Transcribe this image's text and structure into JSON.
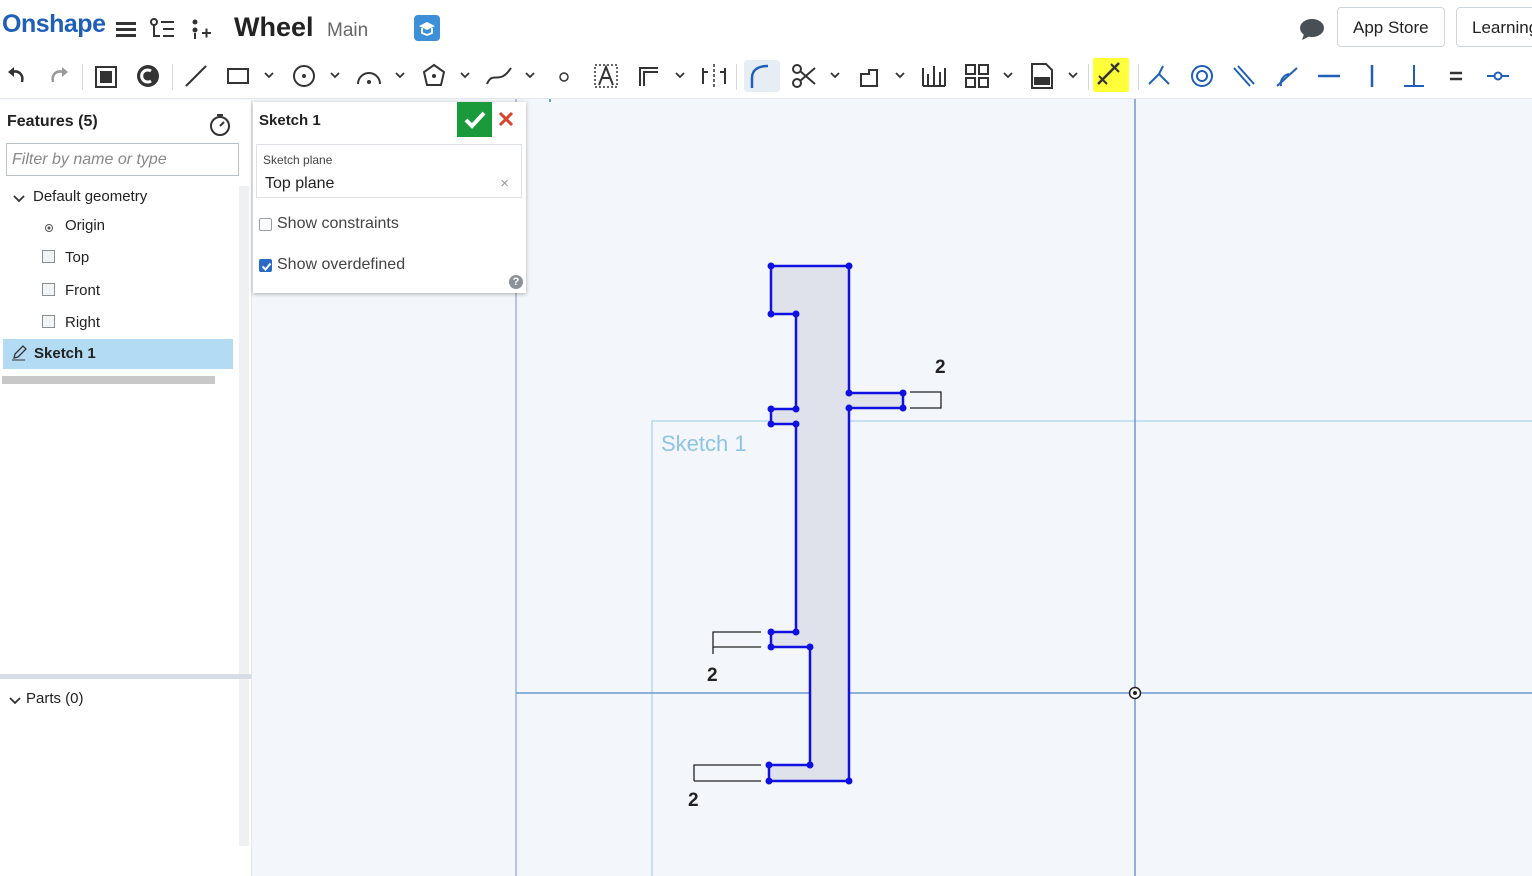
{
  "header": {
    "logo": "Onshape",
    "document_title": "Wheel",
    "workspace": "Main",
    "app_store_label": "App Store",
    "learning_label": "Learning"
  },
  "features": {
    "title": "Features (5)",
    "filter_placeholder": "Filter by name or type",
    "default_geometry": "Default geometry",
    "items": [
      "Origin",
      "Top",
      "Front",
      "Right"
    ],
    "sketch": "Sketch 1",
    "parts": "Parts (0)"
  },
  "dialog": {
    "title": "Sketch 1",
    "plane_label": "Sketch plane",
    "plane_value": "Top plane",
    "show_constraints": "Show constraints",
    "show_constraints_checked": false,
    "show_overdefined": "Show overdefined",
    "show_overdefined_checked": true,
    "help": "?"
  },
  "canvas": {
    "sketch_label": "Sketch 1",
    "dimensions": [
      "2",
      "2",
      "2"
    ]
  },
  "toolbar": {
    "icons": [
      "undo-icon",
      "redo-icon",
      "clipboard-icon",
      "sketch-capture-icon",
      "line-icon",
      "rectangle-icon",
      "circle-icon",
      "arc-icon",
      "polygon-icon",
      "spline-icon",
      "point-icon",
      "text-icon",
      "offset-icon",
      "mirror-icon",
      "fillet-icon",
      "trim-icon",
      "transform-icon",
      "linear-pattern-icon",
      "circular-pattern-icon",
      "dxf-import-icon",
      "dimension-icon",
      "coincident-icon",
      "concentric-icon",
      "parallel-icon",
      "tangent-icon",
      "horizontal-icon",
      "vertical-icon",
      "perpendicular-icon",
      "equal-icon",
      "midpoint-icon"
    ],
    "highlight_color": "#ffff3a"
  },
  "colors": {
    "brand": "#1f5fb8",
    "sketch_line": "#1010e0",
    "ok_button": "#1a9a3b",
    "selected_row": "#b3dbf4"
  }
}
